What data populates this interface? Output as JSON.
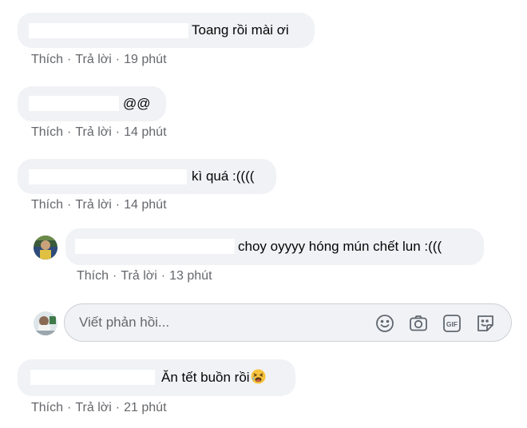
{
  "comments": [
    {
      "text": "Toang rồi mài ơi",
      "like": "Thích",
      "reply": "Trả lời",
      "time": "19 phút"
    },
    {
      "text": "@@",
      "like": "Thích",
      "reply": "Trả lời",
      "time": "14 phút"
    },
    {
      "text": "kì quá :((((",
      "like": "Thích",
      "reply": "Trả lời",
      "time": "14 phút"
    },
    {
      "text": "choy oyyyy hóng mún chết lun :(((",
      "like": "Thích",
      "reply": "Trả lời",
      "time": "13 phút"
    },
    {
      "text": "Ăn tết buồn rồi",
      "like": "Thích",
      "reply": "Trả lời",
      "time": "21 phút"
    }
  ],
  "actions": {
    "separator": "·"
  },
  "reply_box": {
    "placeholder": "Viết phản hồi..."
  },
  "icons": {
    "emoji": "smiley-icon",
    "camera": "camera-icon",
    "gif": "gif-icon",
    "sticker": "sticker-icon",
    "inline_emoji": "tired-face-emoji"
  },
  "colors": {
    "bubble": "#f0f2f5",
    "meta_text": "#65676b",
    "text": "#050505",
    "icon": "#606770"
  }
}
